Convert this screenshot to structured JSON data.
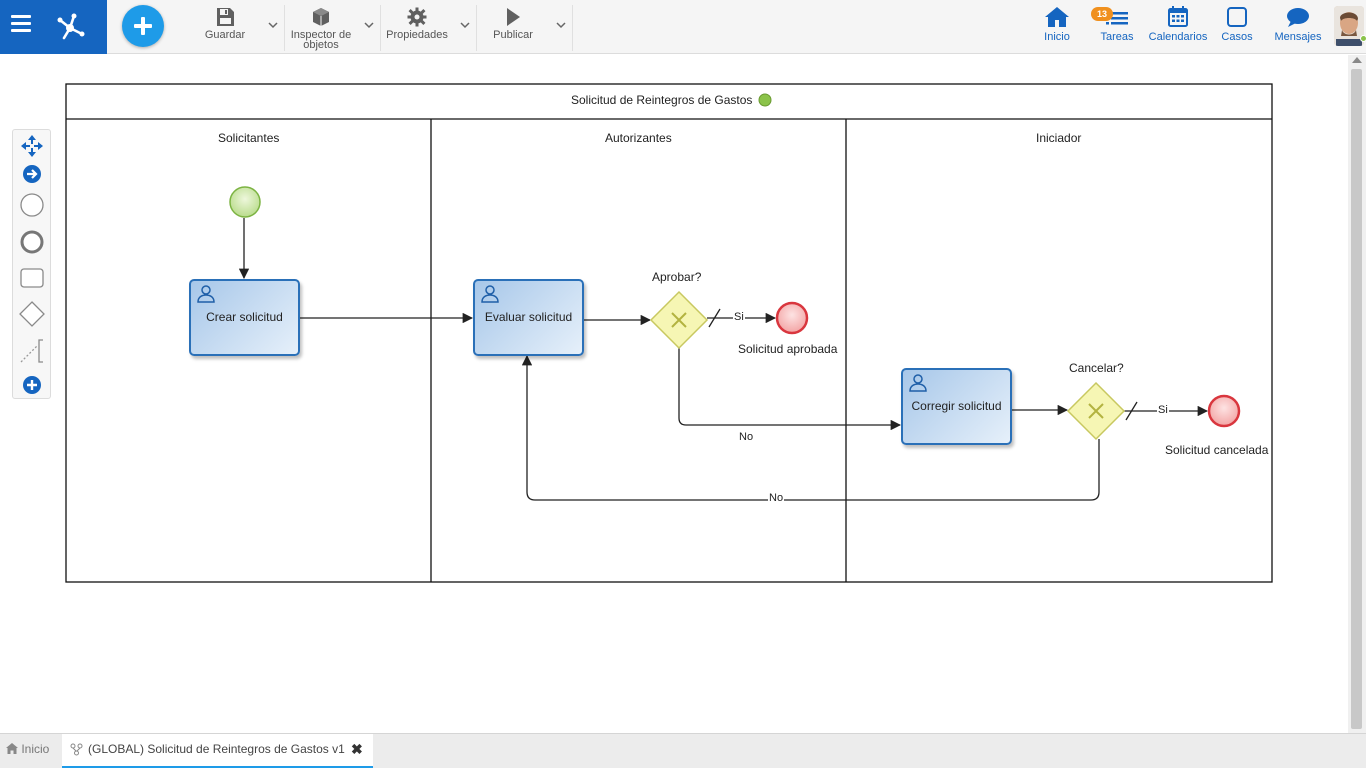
{
  "toolbar": {
    "save_label": "Guardar",
    "inspector_label_line1": "Inspector de",
    "inspector_label_line2": "objetos",
    "properties_label": "Propiedades",
    "publish_label": "Publicar"
  },
  "nav": {
    "home_label": "Inicio",
    "tasks_label": "Tareas",
    "tasks_badge": "13",
    "calendars_label": "Calendarios",
    "cases_label": "Casos",
    "messages_label": "Mensajes"
  },
  "palette": {
    "items": [
      "move-tool",
      "connect-tool",
      "start-event",
      "end-event",
      "task",
      "gateway",
      "annotation",
      "add-more"
    ]
  },
  "diagram": {
    "pool_title": "Solicitud de Reintegros de Gastos",
    "lanes": [
      "Solicitantes",
      "Autorizantes",
      "Iniciador"
    ],
    "tasks": {
      "create": "Crear solicitud",
      "evaluate": "Evaluar solicitud",
      "correct": "Corregir solicitud"
    },
    "gateways": {
      "approve": "Aprobar?",
      "cancel": "Cancelar?"
    },
    "flows": {
      "approve_yes": "Si",
      "approve_no": "No",
      "cancel_yes": "Si",
      "cancel_no": "No"
    },
    "end_events": {
      "approved": "Solicitud aprobada",
      "cancelled": "Solicitud cancelada"
    }
  },
  "colors": {
    "brand_blue": "#1565c0",
    "add_button": "#1e9be8",
    "task_border": "#2a70b8",
    "start_event": "#8bc34a",
    "end_event": "#d9363e",
    "gateway": "#f5f5a8",
    "status_dot": "#8bc34a"
  },
  "tabs": {
    "home_label": "Inicio",
    "active_label": "(GLOBAL) Solicitud de Reintegros de Gastos v1",
    "close_glyph": "✖"
  }
}
